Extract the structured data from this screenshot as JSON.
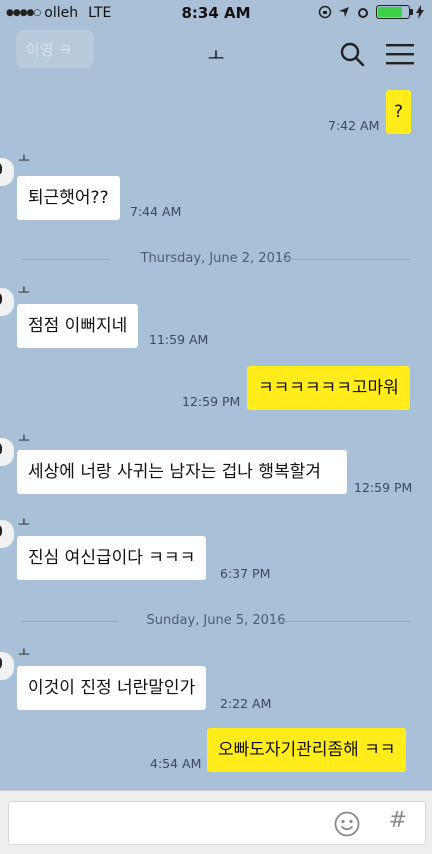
{
  "status_bar": {
    "carrier": "olleh",
    "network": "LTE",
    "time": "8:34 AM",
    "battery_level_pct": 80,
    "colors": {
      "battery": "#3dd14a"
    }
  },
  "header": {
    "back_label": "이영 ㅋ",
    "title": "ㅗ",
    "search_icon": "search-icon",
    "menu_icon": "menu-icon"
  },
  "messages": [
    {
      "side": "out",
      "text": "?",
      "time": "7:42 AM"
    },
    {
      "side": "in",
      "sender": "ㅗ",
      "text": "퇴근햇어??",
      "time": "7:44 AM"
    },
    {
      "side": "in",
      "sender": "ㅗ",
      "text": "점점 이뻐지네",
      "time": "11:59 AM"
    },
    {
      "side": "out",
      "text": "ㅋㅋㅋㅋㅋㅋ고마워",
      "time": "12:59 PM"
    },
    {
      "side": "in",
      "sender": "ㅗ",
      "text": "세상에 너랑 사귀는 남자는 겁나 행복할겨",
      "time": "12:59 PM"
    },
    {
      "side": "in",
      "sender": "ㅗ",
      "text": "진심 여신급이다 ㅋㅋㅋ",
      "time": "6:37 PM"
    },
    {
      "side": "in",
      "sender": "ㅗ",
      "text": "이것이 진정 너란말인가",
      "time": "2:22 AM"
    },
    {
      "side": "out",
      "text": "오빠도자기관리좀해 ㅋㅋ",
      "time": "4:54 AM"
    }
  ],
  "date_separators": [
    "Thursday, June 2, 2016",
    "Sunday, June 5, 2016"
  ],
  "input_bar": {
    "placeholder": "",
    "emoji_icon": "emoji-icon",
    "hash_label": "#"
  },
  "colors": {
    "background": "#a8c0d8",
    "outgoing_bubble": "#ffec1a",
    "incoming_bubble": "#ffffff"
  }
}
